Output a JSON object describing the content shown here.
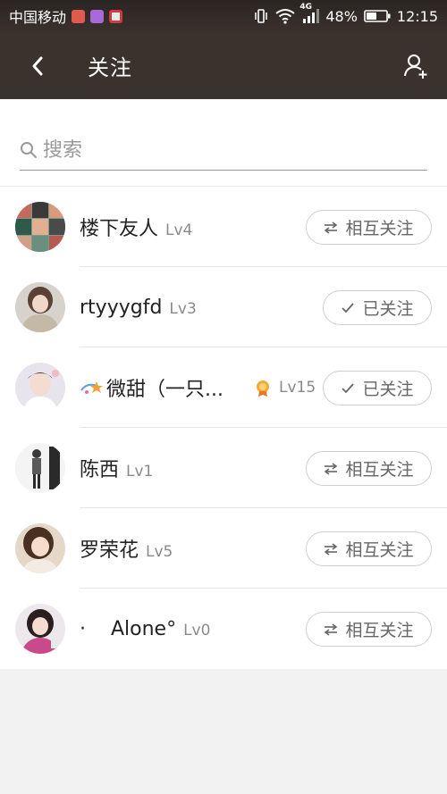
{
  "status_bar": {
    "carrier": "中国移动",
    "network": "4G",
    "battery": "48%",
    "time": "12:15"
  },
  "header": {
    "title": "关注"
  },
  "search": {
    "placeholder": "搜索"
  },
  "users": [
    {
      "name": "楼下友人",
      "level": "Lv4",
      "button": "相互关注",
      "state": "mutual"
    },
    {
      "name": "rtyyygfd",
      "level": "Lv3",
      "button": "已关注",
      "state": "followed"
    },
    {
      "name": "微甜（一只...",
      "level": "Lv15",
      "button": "已关注",
      "state": "followed"
    },
    {
      "name": "陈西",
      "level": "Lv1",
      "button": "相互关注",
      "state": "mutual"
    },
    {
      "name": "罗荣花",
      "level": "Lv5",
      "button": "相互关注",
      "state": "mutual"
    },
    {
      "name": "·    Alone°",
      "level": "Lv0",
      "button": "相互关注",
      "state": "mutual"
    }
  ]
}
